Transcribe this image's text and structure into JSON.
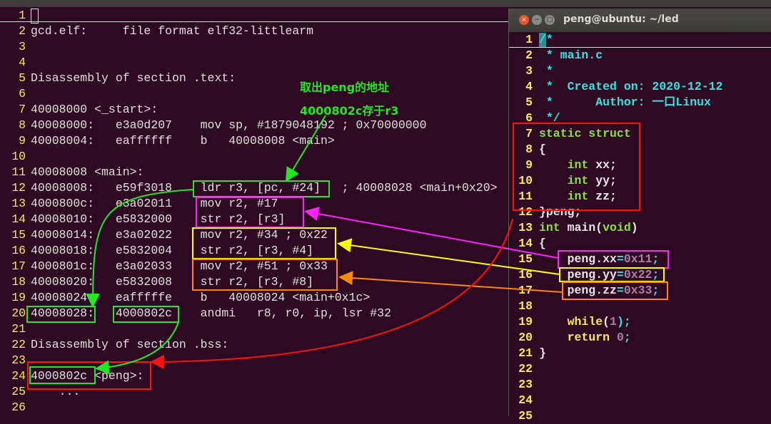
{
  "left_editor": {
    "lines": [
      "",
      "gcd.elf:     file format elf32-littlearm",
      "",
      "",
      "Disassembly of section .text:",
      "",
      "40008000 <_start>:",
      "40008000:   e3a0d207    mov sp, #1879048192 ; 0x70000000",
      "40008004:   eaffffff    b   40008008 <main>",
      "",
      "40008008 <main>:",
      "40008008:   e59f3018    ldr r3, [pc, #24]   ; 40008028 <main+0x20>",
      "4000800c:   e3a02011    mov r2, #17",
      "40008010:   e5832000    str r2, [r3]",
      "40008014:   e3a02022    mov r2, #34 ; 0x22",
      "40008018:   e5832004    str r2, [r3, #4]",
      "4000801c:   e3a02033    mov r2, #51 ; 0x33",
      "40008020:   e5832008    str r2, [r3, #8]",
      "40008024:   eafffffe    b   40008024 <main+0x1c>",
      "40008028:   4000802c    andmi   r8, r0, ip, lsr #32",
      "",
      "Disassembly of section .bss:",
      "",
      "4000802c <peng>:",
      "    ...",
      ""
    ]
  },
  "annotations": {
    "line1": "取出peng的地址",
    "line2": "4000802c存于r3"
  },
  "terminal": {
    "title": "peng@ubuntu: ~/led",
    "buttons": [
      "close",
      "minimize",
      "maximize"
    ],
    "lines": [
      [
        {
          "t": "/*",
          "k": "comment"
        }
      ],
      [
        {
          "t": " * main.c",
          "k": "comment"
        }
      ],
      [
        {
          "t": " *",
          "k": "comment"
        }
      ],
      [
        {
          "t": " *  Created on: 2020-12-12",
          "k": "comment"
        }
      ],
      [
        {
          "t": " *      Author: 一口Linux",
          "k": "comment"
        }
      ],
      [
        {
          "t": " */",
          "k": "comment"
        }
      ],
      [
        {
          "t": "static struct",
          "k": "kw"
        }
      ],
      [
        {
          "t": "{",
          "k": "plain"
        }
      ],
      [
        {
          "t": "    ",
          "k": "plain"
        },
        {
          "t": "int",
          "k": "kw"
        },
        {
          "t": " xx;",
          "k": "plain"
        }
      ],
      [
        {
          "t": "    ",
          "k": "plain"
        },
        {
          "t": "int",
          "k": "kw"
        },
        {
          "t": " yy;",
          "k": "plain"
        }
      ],
      [
        {
          "t": "    ",
          "k": "plain"
        },
        {
          "t": "int",
          "k": "kw"
        },
        {
          "t": " zz;",
          "k": "plain"
        }
      ],
      [
        {
          "t": "}peng;",
          "k": "plain"
        }
      ],
      [
        {
          "t": "int",
          "k": "kw"
        },
        {
          "t": " main(",
          "k": "plain"
        },
        {
          "t": "void",
          "k": "kw"
        },
        {
          "t": ")",
          "k": "plain"
        }
      ],
      [
        {
          "t": "{",
          "k": "plain"
        }
      ],
      [
        {
          "t": "    peng.xx",
          "k": "plain"
        },
        {
          "t": "=",
          "k": "op"
        },
        {
          "t": "0x11",
          "k": "num"
        },
        {
          "t": ";",
          "k": "op"
        }
      ],
      [
        {
          "t": "    peng.yy",
          "k": "plain"
        },
        {
          "t": "=",
          "k": "op"
        },
        {
          "t": "0x22",
          "k": "num"
        },
        {
          "t": ";",
          "k": "op"
        }
      ],
      [
        {
          "t": "    peng.zz",
          "k": "plain"
        },
        {
          "t": "=",
          "k": "op"
        },
        {
          "t": "0x33",
          "k": "num"
        },
        {
          "t": ";",
          "k": "op"
        }
      ],
      [],
      [
        {
          "t": "    ",
          "k": "plain"
        },
        {
          "t": "while",
          "k": "stmt"
        },
        {
          "t": "(",
          "k": "plain"
        },
        {
          "t": "1",
          "k": "num"
        },
        {
          "t": ");",
          "k": "op"
        }
      ],
      [
        {
          "t": "    ",
          "k": "plain"
        },
        {
          "t": "return",
          "k": "stmt"
        },
        {
          "t": " ",
          "k": "plain"
        },
        {
          "t": "0",
          "k": "num"
        },
        {
          "t": ";",
          "k": "op"
        }
      ],
      [
        {
          "t": "}",
          "k": "plain"
        }
      ],
      [],
      [],
      [],
      []
    ]
  },
  "colors": {
    "green": "#22e822",
    "magenta": "#ff22ff",
    "yellow": "#ffff00",
    "orange": "#ff8800",
    "red": "#ff1010"
  }
}
